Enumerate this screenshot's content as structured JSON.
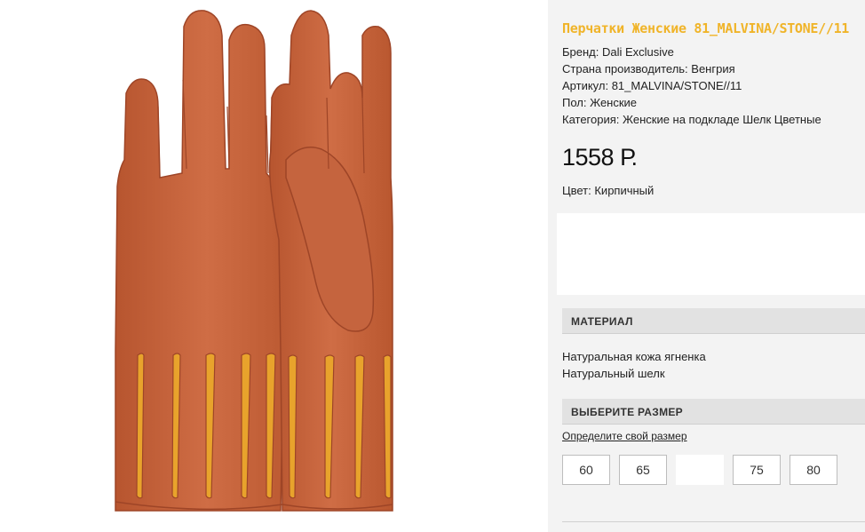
{
  "product": {
    "title": "Перчатки Женские 81_MALVINA/STONE//11",
    "specs": [
      "Бренд: Dali Exclusive",
      "Страна производитель: Венгрия",
      "Артикул: 81_MALVINA/STONE//11",
      "Пол: Женские",
      "Категория: Женские на подкладе Шелк Цветные"
    ],
    "price": "1558 Р.",
    "color": "Цвет: Кирпичный",
    "accent_color": "#f0b429",
    "glove_color": "#c4623d",
    "lining_color": "#e8a32c"
  },
  "material": {
    "header": "МАТЕРИАЛ",
    "items": [
      "Натуральная кожа ягненка",
      "Натуральный шелк"
    ]
  },
  "size": {
    "header": "ВЫБЕРИТЕ РАЗМЕР",
    "guide_link": "Определите свой размер",
    "options": [
      "60",
      "65",
      "",
      "75",
      "80"
    ]
  }
}
